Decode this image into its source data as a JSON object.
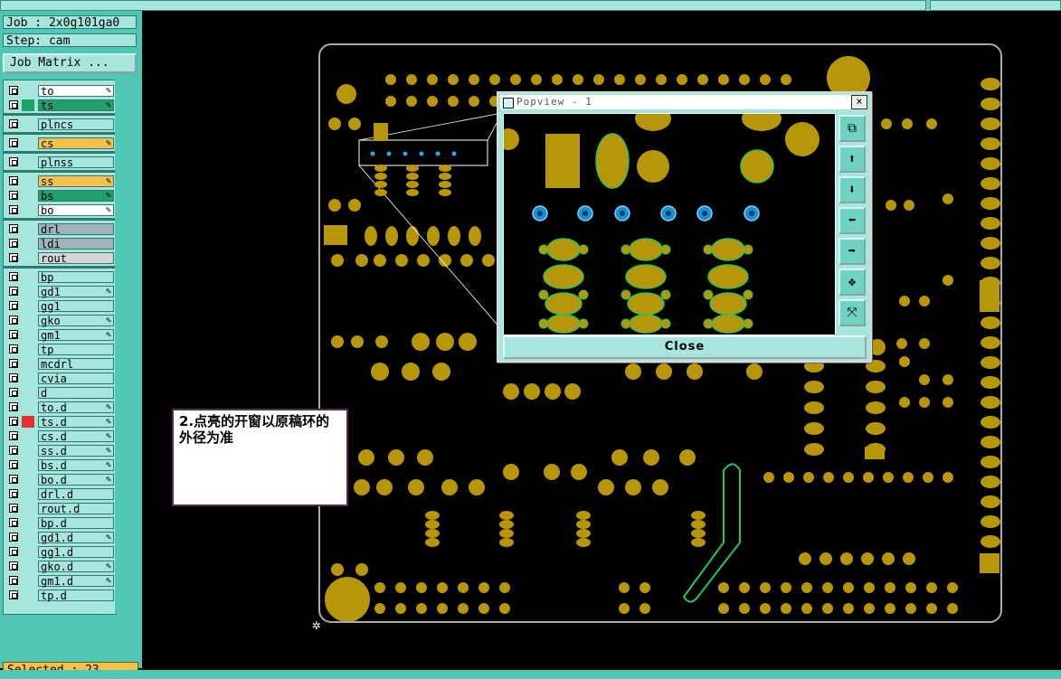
{
  "job": {
    "label": "Job : 2x0g101ga0",
    "step": "Step: cam",
    "matrix_button": "Job Matrix ..."
  },
  "layers": [
    {
      "name": "to",
      "color": "#ffffff",
      "mark": "",
      "pen": true
    },
    {
      "name": "ts",
      "color": "#22a06b",
      "mark": "#22a06b",
      "pen": true
    },
    {
      "name": "plncs",
      "color": "#a6e6dc",
      "mark": "",
      "pen": false
    },
    {
      "name": "cs",
      "color": "#f5c14c",
      "mark": "",
      "pen": true
    },
    {
      "name": "plnss",
      "color": "#a6e6dc",
      "mark": "",
      "pen": false
    },
    {
      "name": "ss",
      "color": "#f5c14c",
      "mark": "",
      "pen": true
    },
    {
      "name": "bs",
      "color": "#22a06b",
      "mark": "",
      "pen": true
    },
    {
      "name": "bo",
      "color": "#ffffff",
      "mark": "",
      "pen": true
    },
    {
      "name": "drl",
      "color": "#9fb3b8",
      "mark": "",
      "pen": false
    },
    {
      "name": "ldi",
      "color": "#9fb3b8",
      "mark": "",
      "pen": false
    },
    {
      "name": "rout",
      "color": "#d6d6d6",
      "mark": "",
      "pen": false
    },
    {
      "name": "bp",
      "color": "#a6e6dc",
      "mark": "",
      "pen": false
    },
    {
      "name": "gd1",
      "color": "#a6e6dc",
      "mark": "",
      "pen": true
    },
    {
      "name": "gg1",
      "color": "#a6e6dc",
      "mark": "",
      "pen": false
    },
    {
      "name": "gko",
      "color": "#a6e6dc",
      "mark": "",
      "pen": true
    },
    {
      "name": "gm1",
      "color": "#a6e6dc",
      "mark": "",
      "pen": true
    },
    {
      "name": "tp",
      "color": "#a6e6dc",
      "mark": "",
      "pen": false
    },
    {
      "name": "mcdrl",
      "color": "#a6e6dc",
      "mark": "",
      "pen": false
    },
    {
      "name": "cvia",
      "color": "#a6e6dc",
      "mark": "",
      "pen": false
    },
    {
      "name": "d",
      "color": "#a6e6dc",
      "mark": "",
      "pen": false
    },
    {
      "name": "to.d",
      "color": "#a6e6dc",
      "mark": "",
      "pen": true
    },
    {
      "name": "ts.d",
      "color": "#a6e6dc",
      "mark": "#e53030",
      "pen": true
    },
    {
      "name": "cs.d",
      "color": "#a6e6dc",
      "mark": "",
      "pen": true
    },
    {
      "name": "ss.d",
      "color": "#a6e6dc",
      "mark": "",
      "pen": true
    },
    {
      "name": "bs.d",
      "color": "#a6e6dc",
      "mark": "",
      "pen": true
    },
    {
      "name": "bo.d",
      "color": "#a6e6dc",
      "mark": "",
      "pen": true
    },
    {
      "name": "drl.d",
      "color": "#a6e6dc",
      "mark": "",
      "pen": false
    },
    {
      "name": "rout.d",
      "color": "#a6e6dc",
      "mark": "",
      "pen": false
    },
    {
      "name": "bp.d",
      "color": "#a6e6dc",
      "mark": "",
      "pen": false
    },
    {
      "name": "gd1.d",
      "color": "#a6e6dc",
      "mark": "",
      "pen": true
    },
    {
      "name": "gg1.d",
      "color": "#a6e6dc",
      "mark": "",
      "pen": false
    },
    {
      "name": "gko.d",
      "color": "#a6e6dc",
      "mark": "",
      "pen": true
    },
    {
      "name": "gm1.d",
      "color": "#a6e6dc",
      "mark": "",
      "pen": true
    },
    {
      "name": "tp.d",
      "color": "#a6e6dc",
      "mark": "",
      "pen": false
    }
  ],
  "status": {
    "selected": "Selected : 23"
  },
  "popview": {
    "title": "Popview - 1",
    "close_label": "Close",
    "close_x": "×"
  },
  "annotation": {
    "text": "2.点亮的开窗以原稿环的外径为准"
  },
  "colors": {
    "pad": "#b8960a",
    "panel": "#4fc7b6",
    "panel_light": "#a6e6dc",
    "via": "#2aa7e0"
  }
}
